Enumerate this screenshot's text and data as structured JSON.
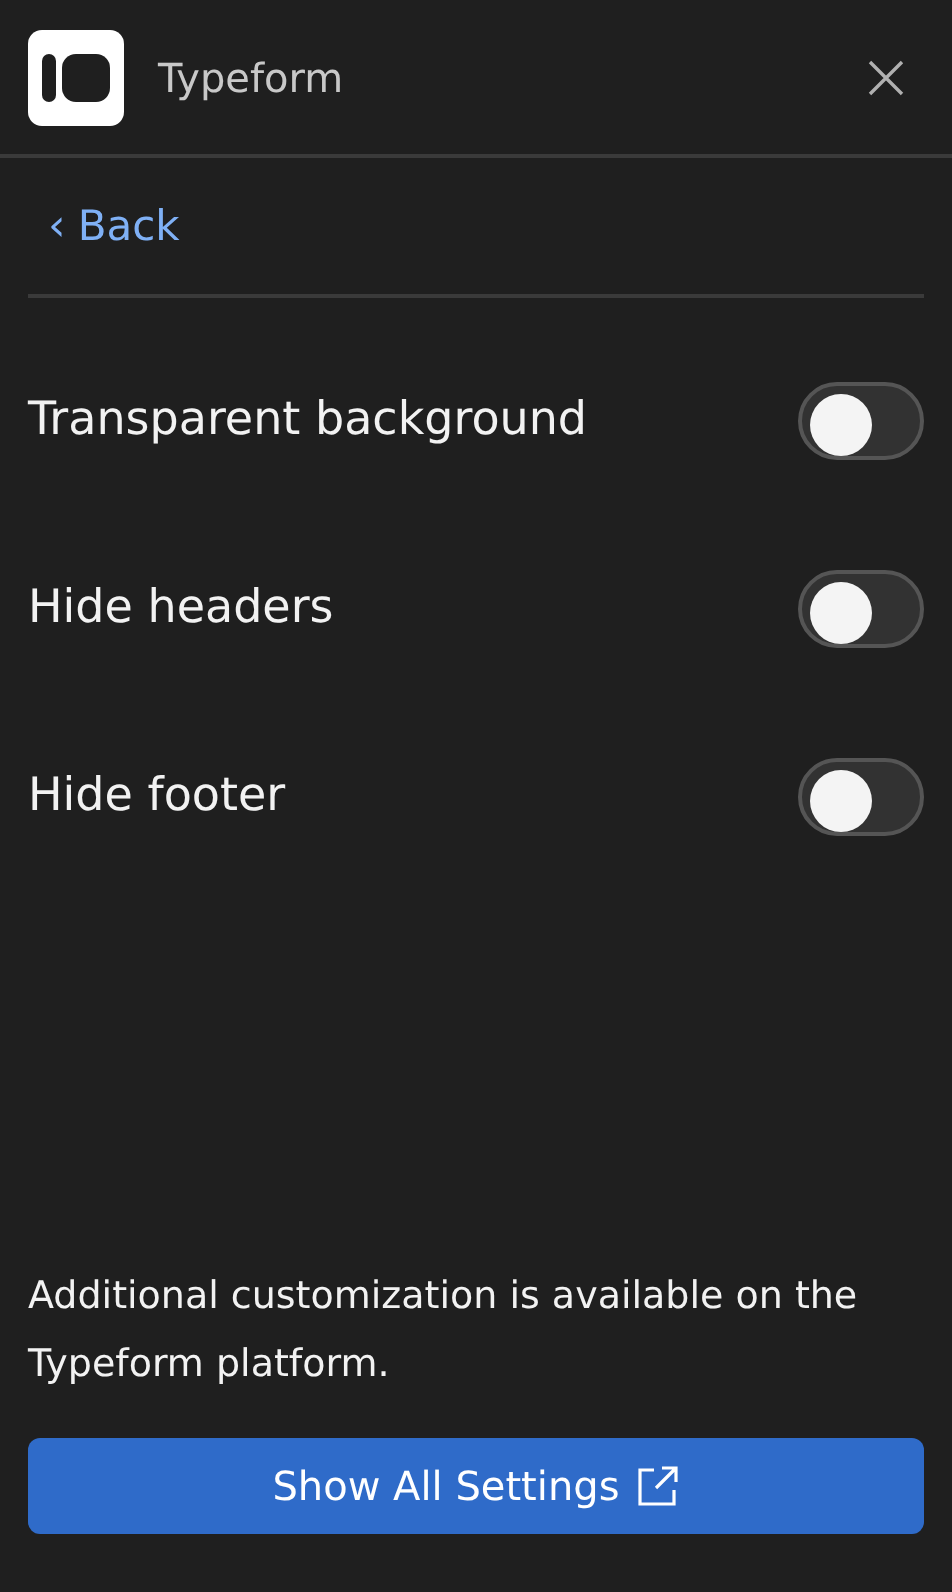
{
  "header": {
    "title": "Typeform"
  },
  "back": {
    "label": "Back",
    "icon": "‹"
  },
  "settings": [
    {
      "label": "Transparent background",
      "on": false
    },
    {
      "label": "Hide headers",
      "on": false
    },
    {
      "label": "Hide footer",
      "on": false
    }
  ],
  "note": "Additional customization is available on the Typeform platform.",
  "button": {
    "label": "Show All Settings"
  }
}
